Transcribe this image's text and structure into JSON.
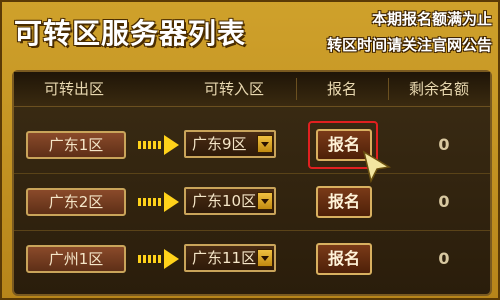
{
  "title": "可转区服务器列表",
  "notice": {
    "line1": "本期报名额满为止",
    "line2": "转区时间请关注官网公告"
  },
  "table": {
    "headers": [
      "可转出区",
      "可转入区",
      "报名",
      "剩余名额"
    ],
    "rows": [
      {
        "from": "广东1区",
        "to": "广东9区",
        "signup": "报名",
        "remaining": "0",
        "highlighted": true
      },
      {
        "from": "广东2区",
        "to": "广东10区",
        "signup": "报名",
        "remaining": "0",
        "highlighted": false
      },
      {
        "from": "广州1区",
        "to": "广东11区",
        "signup": "报名",
        "remaining": "0",
        "highlighted": false
      }
    ]
  },
  "icons": {
    "arrow": "arrow-right-icon",
    "dropdown": "chevron-down-icon",
    "cursor": "pointer-cursor-icon"
  },
  "colors": {
    "panel": "#c89a28",
    "table_bg": "#2e2010",
    "highlight": "#e02020",
    "arrow": "#ffd21a"
  }
}
